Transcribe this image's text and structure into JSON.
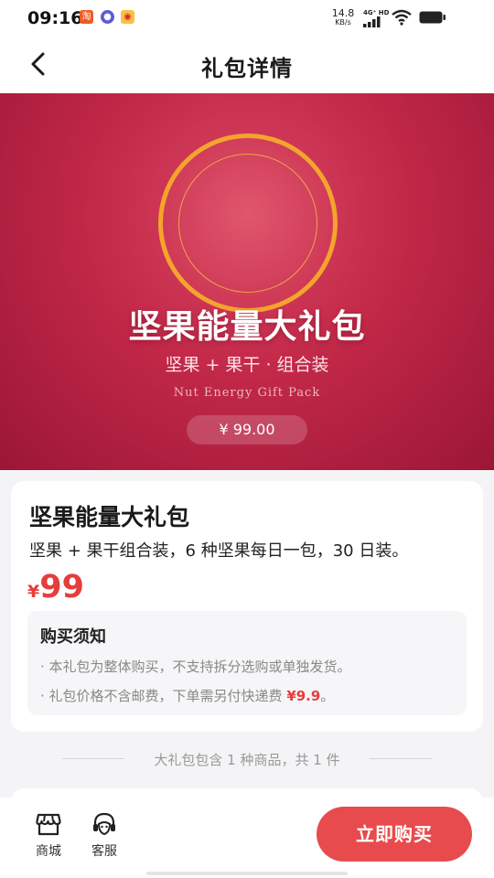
{
  "status_bar": {
    "time": "09:16",
    "net_speed_value": "14.8",
    "net_speed_unit": "KB/s",
    "network_label": "4G⁺ HD",
    "app_icons": [
      "taobao-icon",
      "app-icon",
      "weibo-icon"
    ]
  },
  "nav": {
    "title": "礼包详情",
    "back_icon": "chevron-left-icon"
  },
  "banner": {
    "title": "坚果能量大礼包",
    "subtitle": "坚果 + 果干 · 组合装",
    "english": "Nut Energy Gift Pack",
    "price": "¥ 99.00"
  },
  "product": {
    "name": "坚果能量大礼包",
    "description": "坚果 + 果干组合装，6 种坚果每日一包，30 日装。",
    "price_symbol": "¥",
    "price": "99"
  },
  "notice": {
    "title": "购买须知",
    "items": [
      {
        "text": "· 本礼包为整体购买，不支持拆分选购或单独发货。",
        "highlight": ""
      },
      {
        "text": "· 礼包价格不含邮费，下单需另付快递费 ",
        "highlight": "¥9.9",
        "suffix": "。"
      }
    ]
  },
  "contents_count": "大礼包包含 1 种商品，共 1 件",
  "bottom_bar": {
    "tabs": [
      {
        "label": "商城",
        "icon": "store-icon"
      },
      {
        "label": "客服",
        "icon": "headset-icon"
      }
    ],
    "buy_label": "立即购买"
  },
  "colors": {
    "accent": "#e84b4d",
    "price_red": "#e53d3d",
    "banner_red": "#c22848",
    "ring_gold": "#f4a42c"
  }
}
